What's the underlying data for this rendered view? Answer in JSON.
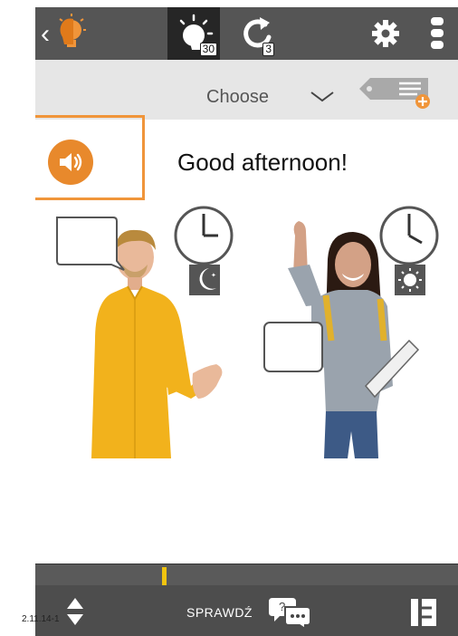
{
  "topbar": {
    "lesson_badge": "30",
    "repeat_badge": "3"
  },
  "choose": {
    "label": "Choose"
  },
  "lesson": {
    "phrase": "Good afternoon!"
  },
  "progress": {
    "value_fraction": 0.3
  },
  "bottombar": {
    "check_label": "SPRAWDŹ",
    "check_icon_text": "?..."
  },
  "version": "2.11.14-1",
  "colors": {
    "accent": "#e8892c",
    "highlight_frame": "#f0953a",
    "topbar": "#555555",
    "active_tab": "#262626",
    "progress_marker": "#f1c40f",
    "shirt_yellow": "#f2b21c"
  },
  "icons": [
    "back-bulb-icon",
    "lesson-sun-icon",
    "repeat-icon",
    "gear-icon",
    "more-vertical-icon",
    "chevron-down-icon",
    "tag-list-add-icon",
    "speaker-icon",
    "clock-icon",
    "moon-icon",
    "sun-icon",
    "speech-bubble-icon",
    "up-down-arrow-icon",
    "chat-question-icon",
    "list-view-icon"
  ]
}
